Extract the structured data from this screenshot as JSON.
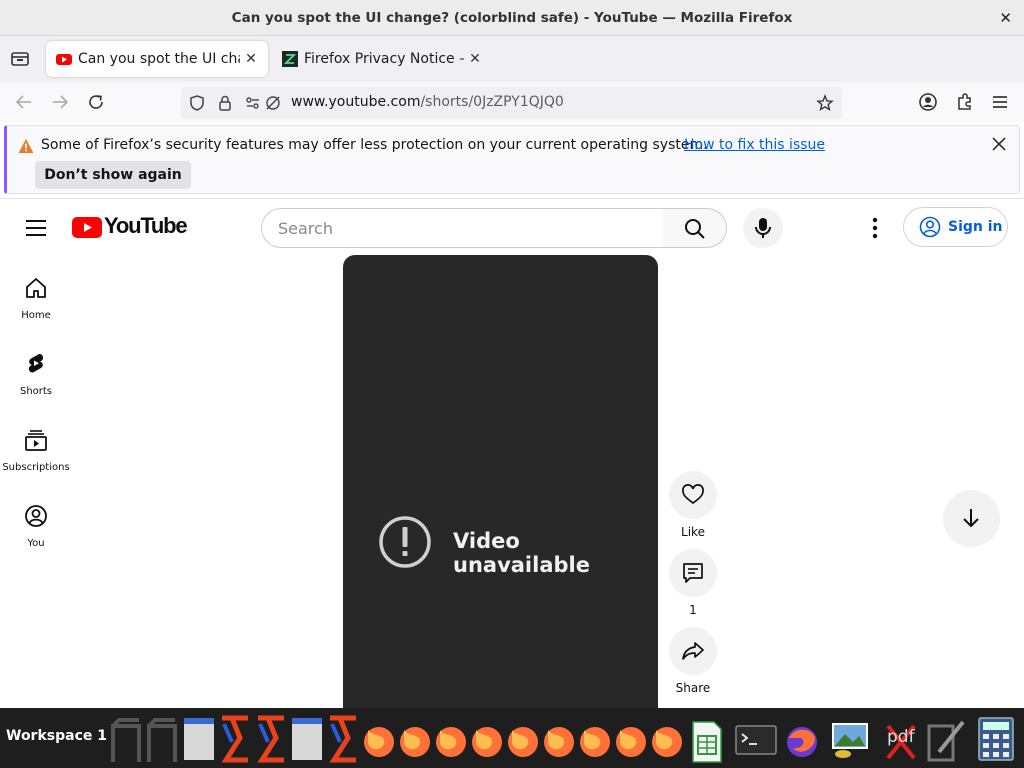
{
  "window": {
    "title": "Can you spot the UI change? (colorblind safe) - YouTube — Mozilla Firefox",
    "close_glyph": "✕"
  },
  "tabs": [
    {
      "label": "Can you spot the UI change? (colorblind safe) - YouTube",
      "favicon": "youtube-favicon",
      "active": true
    },
    {
      "label": "Firefox Privacy Notice — Mozilla",
      "favicon": "mozilla-favicon",
      "active": false
    }
  ],
  "tabstrip": {
    "new_tab": "+",
    "close_glyph": "✕"
  },
  "urlbar": {
    "host": "www.youtube.com",
    "path": "/shorts/0JzZPY1QJQ0"
  },
  "notification": {
    "message": "Some of Firefox’s security features may offer less protection on your current operating system.",
    "link": "How to fix this issue",
    "button": "Don’t show again"
  },
  "youtube": {
    "wordmark": "YouTube",
    "search_placeholder": "Search",
    "sign_in": "Sign in",
    "sidebar": [
      {
        "label": "Home",
        "icon": "home-icon"
      },
      {
        "label": "Shorts",
        "icon": "shorts-icon"
      },
      {
        "label": "Subscriptions",
        "icon": "subscriptions-icon"
      },
      {
        "label": "You",
        "icon": "you-icon"
      }
    ],
    "player": {
      "message": "Video unavailable"
    },
    "actions": {
      "like": "Like",
      "comments": "1",
      "share": "Share"
    }
  },
  "taskbar": {
    "workspace": "Workspace 1",
    "pdf_label": "pdf"
  },
  "colors": {
    "youtube_red": "#ff0000",
    "link_blue": "#065fd4",
    "notification_accent": "#9059ff"
  }
}
